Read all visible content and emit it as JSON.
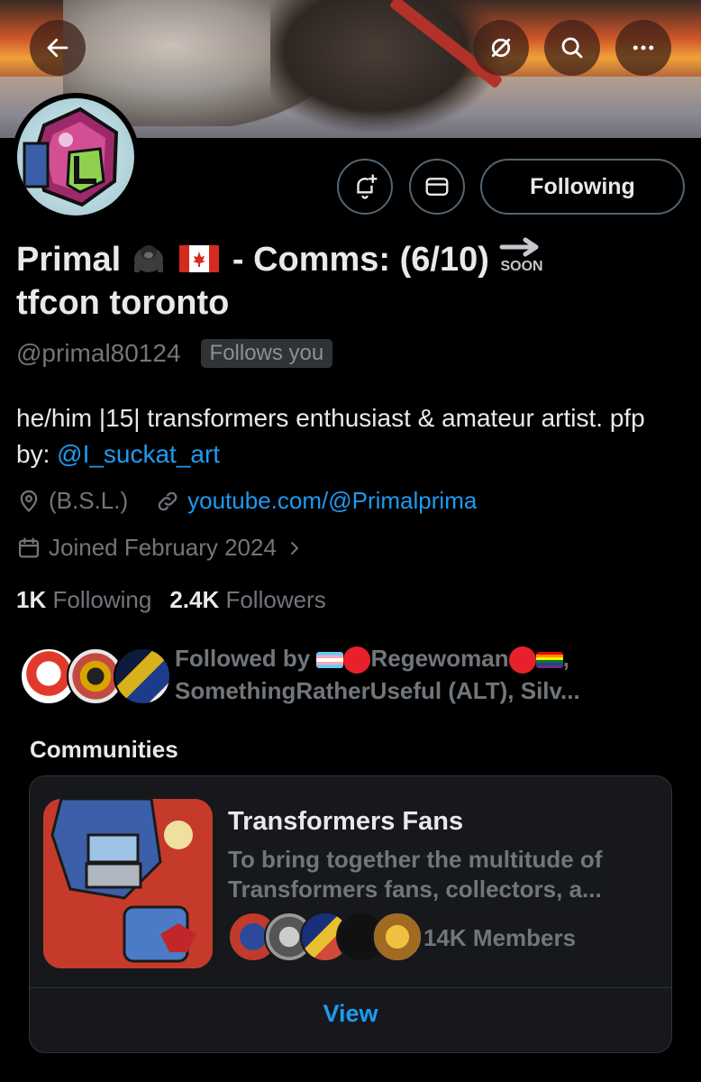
{
  "header": {
    "back_icon": "arrow-left-icon",
    "grok_icon": "slashed-circle-icon",
    "search_icon": "search-icon",
    "more_icon": "more-horizontal-icon"
  },
  "actions": {
    "notify_icon": "bell-plus-icon",
    "message_icon": "envelope-icon",
    "following_label": "Following"
  },
  "profile": {
    "name_line1": "Primal",
    "name_after_emoji": "- Comms: (6/10)",
    "soon_label": "SOON",
    "name_line2": "tfcon toronto",
    "handle": "@primal80124",
    "follows_you": "Follows you",
    "bio_text": "he/him |15| transformers enthusiast & amateur artist. pfp by: ",
    "bio_mention": "@I_suckat_art",
    "location": "(B.S.L.)",
    "website": "youtube.com/@Primalprima",
    "joined": "Joined February 2024",
    "following_count": "1K",
    "following_label": "Following",
    "followers_count": "2.4K",
    "followers_label": "Followers"
  },
  "followed_by": {
    "prefix": "Followed by",
    "name1": "Regewoman",
    "comma1": ",",
    "line2": "SomethingRatherUseful (ALT), Silv..."
  },
  "communities": {
    "heading": "Communities",
    "title": "Transformers Fans",
    "description": "To bring together the multitude of Transformers fans, collectors, a...",
    "members": "14K Members",
    "view_label": "View"
  },
  "colors": {
    "accent": "#1d9bf0",
    "secondary_text": "#71767b",
    "background": "#000000"
  }
}
